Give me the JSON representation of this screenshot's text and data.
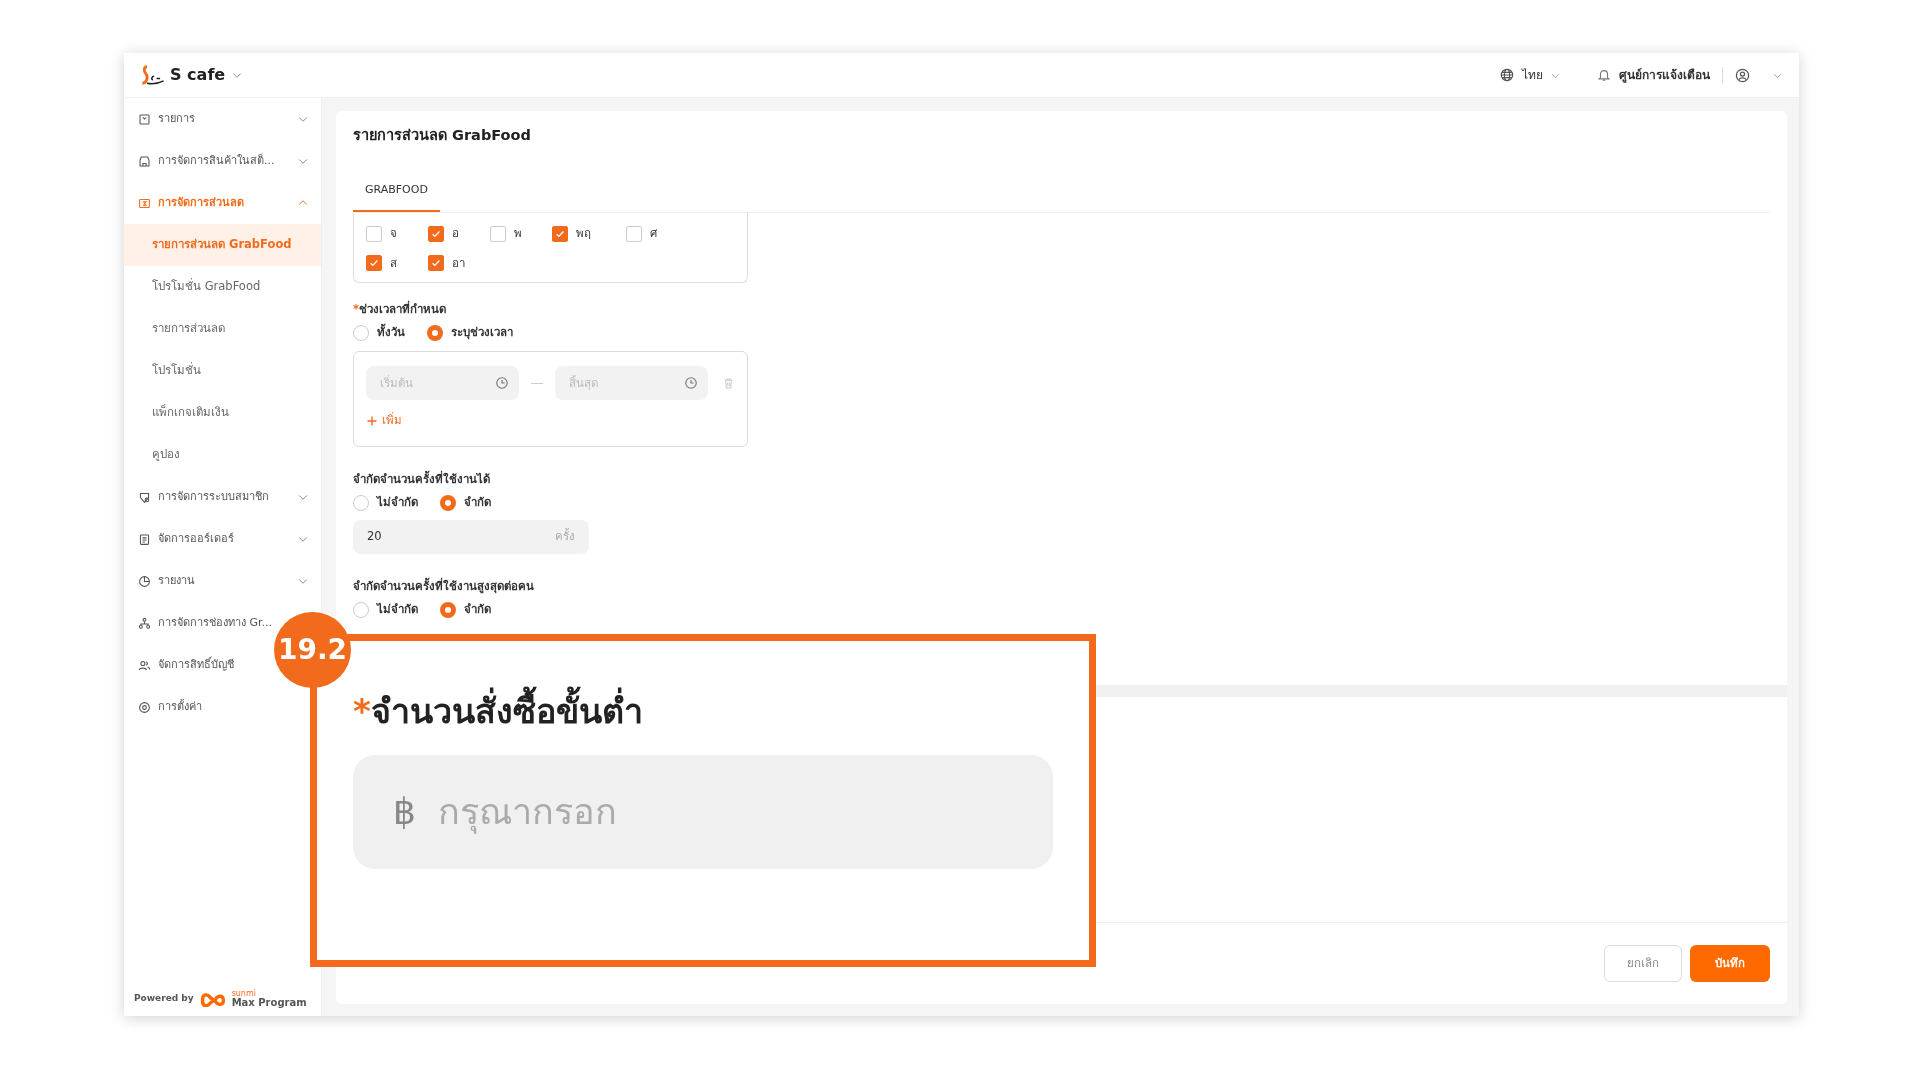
{
  "header": {
    "brand": "S cafe",
    "language": "ไทย",
    "notifications": "ศูนย์การแจ้งเตือน"
  },
  "sidebar": {
    "items": [
      {
        "label": "รายการ",
        "kind": "group",
        "expanded": false
      },
      {
        "label": "การจัดการสินค้าในสต็...",
        "kind": "group",
        "expanded": false
      },
      {
        "label": "การจัดการส่วนลด",
        "kind": "group",
        "expanded": true,
        "children": [
          {
            "label": "รายการส่วนลด GrabFood",
            "selected": true
          },
          {
            "label": "โปรโมชั่น GrabFood",
            "selected": false
          },
          {
            "label": "รายการส่วนลด",
            "selected": false
          },
          {
            "label": "โปรโมชั่น",
            "selected": false
          },
          {
            "label": "แพ็กเกจเติมเงิน",
            "selected": false
          },
          {
            "label": "คูปอง",
            "selected": false
          }
        ]
      },
      {
        "label": "การจัดการระบบสมาชิก",
        "kind": "group",
        "expanded": false
      },
      {
        "label": "จัดการออร์เดอร์",
        "kind": "group",
        "expanded": false
      },
      {
        "label": "รายงาน",
        "kind": "group",
        "expanded": false
      },
      {
        "label": "การจัดการช่องทาง Gr...",
        "kind": "link"
      },
      {
        "label": "จัดการสิทธิ์บัญชี",
        "kind": "link"
      },
      {
        "label": "การตั้งค่า",
        "kind": "link"
      }
    ],
    "footer": {
      "powered_by": "Powered by",
      "maker": "sunmi",
      "product": "Max Program"
    }
  },
  "page": {
    "title": "รายการส่วนลด GrabFood",
    "tabs": [
      {
        "label": "GRABFOOD",
        "selected": true
      }
    ],
    "days": [
      {
        "label": "จ",
        "checked": false
      },
      {
        "label": "อ",
        "checked": true
      },
      {
        "label": "พ",
        "checked": false
      },
      {
        "label": "พฤ",
        "checked": true
      },
      {
        "label": "ศ",
        "checked": false
      },
      {
        "label": "ส",
        "checked": true
      },
      {
        "label": "อา",
        "checked": true
      }
    ],
    "time_range": {
      "required_mark": "*",
      "label": "ช่วงเวลาที่กำหนด",
      "options": [
        {
          "label": "ทั้งวัน",
          "selected": false
        },
        {
          "label": "ระบุช่วงเวลา",
          "selected": true
        }
      ],
      "start_placeholder": "เริ่มต้น",
      "end_placeholder": "สิ้นสุด",
      "add": "เพิ่ม"
    },
    "usage_limit": {
      "label": "จำกัดจำนวนครั้งที่ใช้งานได้",
      "options": [
        {
          "label": "ไม่จำกัด",
          "selected": false
        },
        {
          "label": "จำกัด",
          "selected": true
        }
      ],
      "value": "20",
      "unit": "ครั้ง"
    },
    "per_person_limit": {
      "label": "จำกัดจำนวนครั้งที่ใช้งานสูงสุดต่อคน",
      "options": [
        {
          "label": "ไม่จำกัด",
          "selected": false
        },
        {
          "label": "จำกัด",
          "selected": true
        }
      ]
    },
    "buttons": {
      "cancel": "ยกเลิก",
      "save": "บันทึก"
    }
  },
  "callout": {
    "step": "19.2",
    "required_mark": "*",
    "label": "จำนวนสั่งซื้อขั้นต่ำ",
    "prefix": "฿",
    "placeholder": "กรุณากรอก"
  }
}
